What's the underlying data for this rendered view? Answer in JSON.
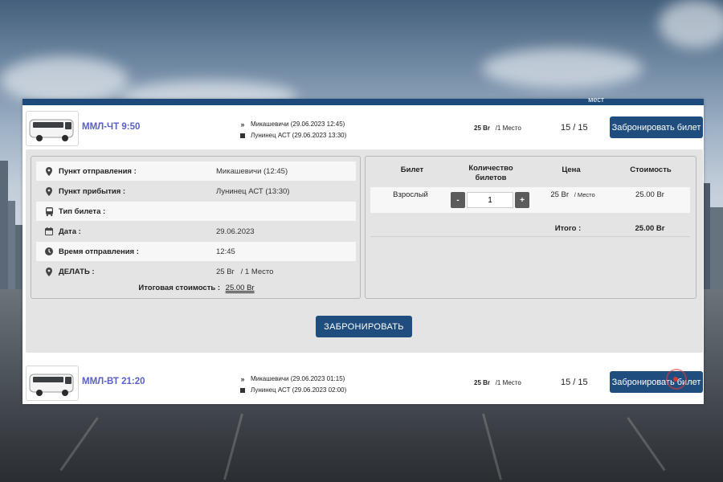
{
  "panel_header": {
    "seats_label": "мест"
  },
  "trips": [
    {
      "name": "ММЛ-ЧТ 9:50",
      "from": "Микашевичи (29.06.2023 12:45)",
      "to": "Лунинец АСТ (29.06.2023 13:30)",
      "price": "25 Br",
      "price_unit": "/1 Место",
      "seats": "15 / 15",
      "book_label": "Забронировать билет"
    },
    {
      "name": "ММЛ-ВТ 21:20",
      "from": "Микашевичи (29.06.2023 01:15)",
      "to": "Лунинец АСТ (29.06.2023 02:00)",
      "price": "25 Br",
      "price_unit": "/1 Место",
      "seats": "15 / 15",
      "book_label": "Забронировать билет"
    }
  ],
  "details": {
    "rows": [
      {
        "icon": "map-marker-icon",
        "label": "Пункт отправления :",
        "value": "Микашевичи (12:45)"
      },
      {
        "icon": "map-marker-icon",
        "label": "Пункт прибытия :",
        "value": "Лунинец АСТ (13:30)"
      },
      {
        "icon": "bus-icon",
        "label": "Тип билета :",
        "value": ""
      },
      {
        "icon": "calendar-icon",
        "label": "Дата :",
        "value": "29.06.2023"
      },
      {
        "icon": "clock-icon",
        "label": "Время отправления :",
        "value": "12:45"
      },
      {
        "icon": "map-marker-icon",
        "label": "ДЕЛАТЬ :",
        "value": "25 Br   / 1 Место"
      }
    ],
    "total_label": "Итоговая стоимость :",
    "total_value": "25.00 Br"
  },
  "ticket_table": {
    "headers": [
      "Билет",
      "Количество билетов",
      "Цена",
      "Стоимость"
    ],
    "row": {
      "ticket": "Взрослый",
      "minus": "-",
      "quantity": "1",
      "plus": "+",
      "price": "25 Br",
      "price_unit": "/ Место",
      "cost": "25.00 Br"
    },
    "total_label": "Итого :",
    "total_value": "25.00 Br"
  },
  "book_button": "ЗАБРОНИРОВАТЬ",
  "colors": {
    "accent": "#1f4d7e",
    "trip_name": "#5a5fc8",
    "panel_bg": "#e4e4e4"
  }
}
